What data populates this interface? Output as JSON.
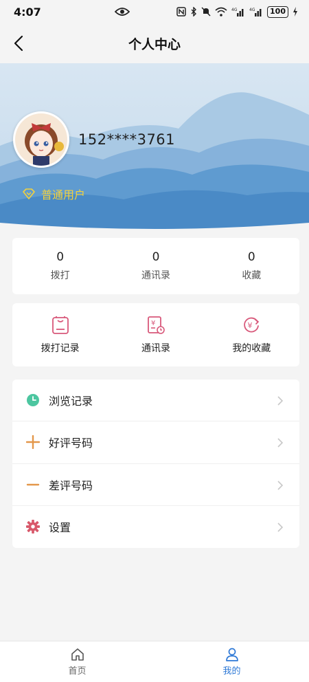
{
  "status_bar": {
    "time": "4:07",
    "battery": "100"
  },
  "header": {
    "title": "个人中心"
  },
  "profile": {
    "phone": "152****3761",
    "level": "普通用户"
  },
  "stats": [
    {
      "value": "0",
      "label": "拨打"
    },
    {
      "value": "0",
      "label": "通讯录"
    },
    {
      "value": "0",
      "label": "收藏"
    }
  ],
  "shortcuts": [
    {
      "label": "拨打记录",
      "icon": "call-record-icon"
    },
    {
      "label": "通讯录",
      "icon": "contacts-icon"
    },
    {
      "label": "我的收藏",
      "icon": "favorites-icon"
    }
  ],
  "menu": [
    {
      "label": "浏览记录",
      "icon": "clock-icon"
    },
    {
      "label": "好评号码",
      "icon": "plus-icon"
    },
    {
      "label": "差评号码",
      "icon": "minus-icon"
    },
    {
      "label": "设置",
      "icon": "gear-icon"
    }
  ],
  "tabs": [
    {
      "label": "首页",
      "icon": "home-icon"
    },
    {
      "label": "我的",
      "icon": "user-icon"
    }
  ],
  "colors": {
    "accent": "#2d78d6",
    "level_gold": "#f4d23c",
    "shortcut_pink": "#d8587a",
    "clock_green": "#4cc6a0",
    "plus_orange": "#e3974a",
    "gear_red": "#d8586a"
  }
}
